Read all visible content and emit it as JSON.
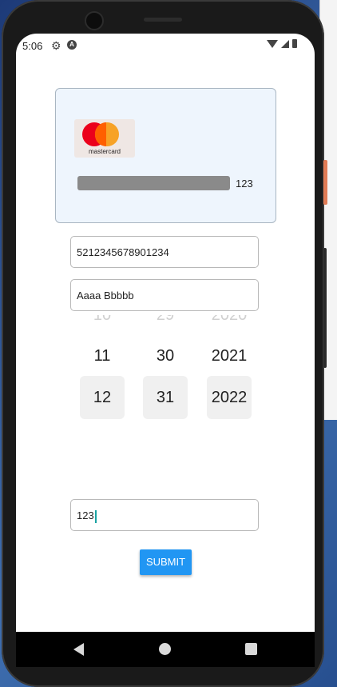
{
  "status_bar": {
    "time": "5:06",
    "icons": [
      "gear-icon",
      "a-badge-icon",
      "wifi-icon",
      "signal-icon",
      "battery-icon"
    ]
  },
  "card_preview": {
    "brand_text": "mastercard",
    "cvv": "123",
    "background": "#eef5fd"
  },
  "form": {
    "card_number": "5212345678901234",
    "card_holder": "Aaaa Bbbbb",
    "expiry_picker": {
      "month": {
        "faded": "10",
        "above": "11",
        "selected": "12"
      },
      "day": {
        "faded": "29",
        "above": "30",
        "selected": "31"
      },
      "year": {
        "faded": "2020",
        "above": "2021",
        "selected": "2022"
      }
    },
    "cvv": "123",
    "submit_label": "SUBMIT"
  },
  "colors": {
    "accent": "#2196f3",
    "cursor": "#1aa3a3",
    "mastercard_red": "#eb001b",
    "mastercard_orange": "#f79e1b"
  },
  "nav_bar": {
    "icons": [
      "back-icon",
      "home-icon",
      "recents-icon"
    ]
  }
}
